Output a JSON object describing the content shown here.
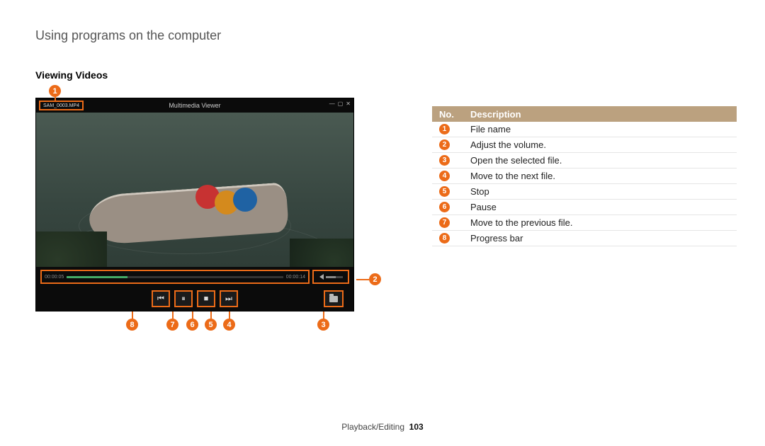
{
  "page": {
    "breadcrumb_title": "Using programs on the computer",
    "section_title": "Viewing Videos",
    "footer_section": "Playback/Editing",
    "footer_page": "103"
  },
  "player": {
    "file_name": "SAM_0003.MP4",
    "app_title": "Multimedia Viewer",
    "time_elapsed": "00:00:05",
    "time_total": "00:00:14"
  },
  "callouts": {
    "c1": "1",
    "c2": "2",
    "c3": "3",
    "c4": "4",
    "c5": "5",
    "c6": "6",
    "c7": "7",
    "c8": "8"
  },
  "legend": {
    "header_no": "No.",
    "header_desc": "Description",
    "rows": [
      {
        "num": "1",
        "desc": "File name"
      },
      {
        "num": "2",
        "desc": "Adjust the volume."
      },
      {
        "num": "3",
        "desc": "Open the selected file."
      },
      {
        "num": "4",
        "desc": "Move to the next file."
      },
      {
        "num": "5",
        "desc": "Stop"
      },
      {
        "num": "6",
        "desc": "Pause"
      },
      {
        "num": "7",
        "desc": "Move to the previous file."
      },
      {
        "num": "8",
        "desc": "Progress bar"
      }
    ]
  }
}
